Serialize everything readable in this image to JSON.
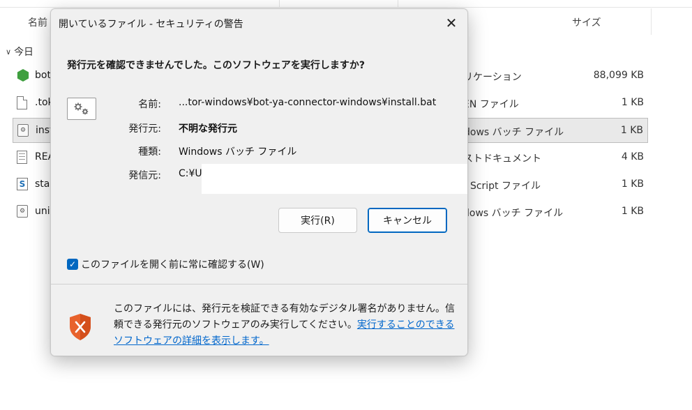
{
  "explorer": {
    "column_name": "名前",
    "column_size": "サイズ",
    "group_label": "今日",
    "files": [
      {
        "name": "bot",
        "type": "リケーション",
        "size": "88,099 KB",
        "icon": "app-gem-icon"
      },
      {
        "name": ".tok",
        "type": "EN ファイル",
        "size": "1 KB",
        "icon": "file-icon"
      },
      {
        "name": "inst",
        "type": "dows バッチ ファイル",
        "size": "1 KB",
        "icon": "batch-file-icon",
        "selected": true
      },
      {
        "name": "REA",
        "type": "ストドキュメント",
        "size": "4 KB",
        "icon": "text-document-icon"
      },
      {
        "name": "sta",
        "type": "t Script ファイル",
        "size": "1 KB",
        "icon": "script-file-icon"
      },
      {
        "name": "uni",
        "type": "dows バッチ ファイル",
        "size": "1 KB",
        "icon": "batch-file-icon"
      }
    ]
  },
  "dialog": {
    "title": "開いているファイル - セキュリティの警告",
    "close_symbol": "✕",
    "question": "発行元を確認できませんでした。このソフトウェアを実行しますか?",
    "info": {
      "name_label": "名前:",
      "name_value": "...tor-windows¥bot-ya-connector-windows¥install.bat",
      "publisher_label": "発行元:",
      "publisher_value": "不明な発行元",
      "type_label": "種類:",
      "type_value": "Windows バッチ ファイル",
      "from_label": "発信元:",
      "from_value": "C:¥U"
    },
    "run_button": "実行(R)",
    "cancel_button": "キャンセル",
    "checkbox_label": "このファイルを開く前に常に確認する(W)",
    "checkbox_checked": true,
    "warning_text": "このファイルには、発行元を検証できる有効なデジタル署名がありません。信頼できる発行元のソフトウェアのみ実行してください。",
    "warning_link": "実行することのできるソフトウェアの詳細を表示します。"
  },
  "colors": {
    "accent": "#0067c0",
    "link": "#0066cc",
    "shield_orange": "#e8622c"
  }
}
